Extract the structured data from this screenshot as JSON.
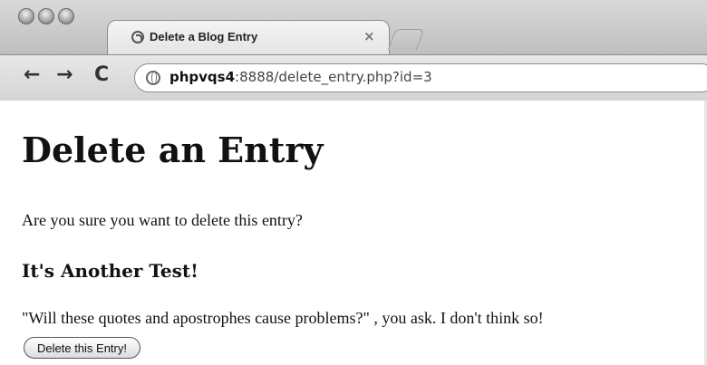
{
  "browser": {
    "tab": {
      "title": "Delete a Blog Entry",
      "close_glyph": "×",
      "favicon": "globe-icon"
    },
    "toolbar": {
      "back_glyph": "←",
      "forward_glyph": "→",
      "reload_glyph": "C",
      "url_host": "phpvqs4",
      "url_rest": ":8888/delete_entry.php?id=3",
      "site_icon": "globe-icon"
    }
  },
  "page": {
    "title": "Delete an Entry",
    "prompt": "Are you sure you want to delete this entry?",
    "entry_title": "It's Another Test!",
    "entry_body": "\"Will these quotes and apostrophes cause problems?\" , you ask. I don't think so!",
    "delete_button": "Delete this Entry!"
  }
}
